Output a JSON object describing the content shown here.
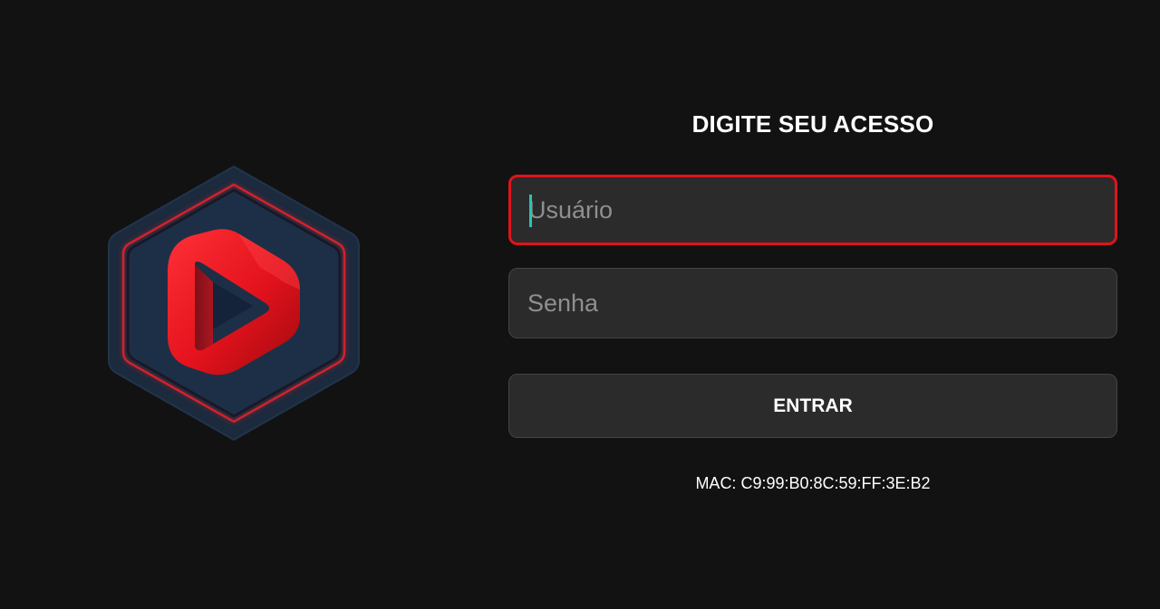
{
  "login": {
    "title": "DIGITE SEU ACESSO",
    "username_placeholder": "Usuário",
    "username_value": "",
    "password_placeholder": "Senha",
    "password_value": "",
    "submit_label": "ENTRAR",
    "mac_text": "MAC: C9:99:B0:8C:59:FF:3E:B2"
  },
  "logo": {
    "icon": "play-hexagon-logo",
    "hex_fill": "#1e2f45",
    "ring_color": "#e0222b",
    "play_color": "#e8151f"
  },
  "colors": {
    "background": "#121212",
    "field_bg": "#2b2b2b",
    "focus_border": "#e0131b",
    "caret": "#26c6b4"
  }
}
